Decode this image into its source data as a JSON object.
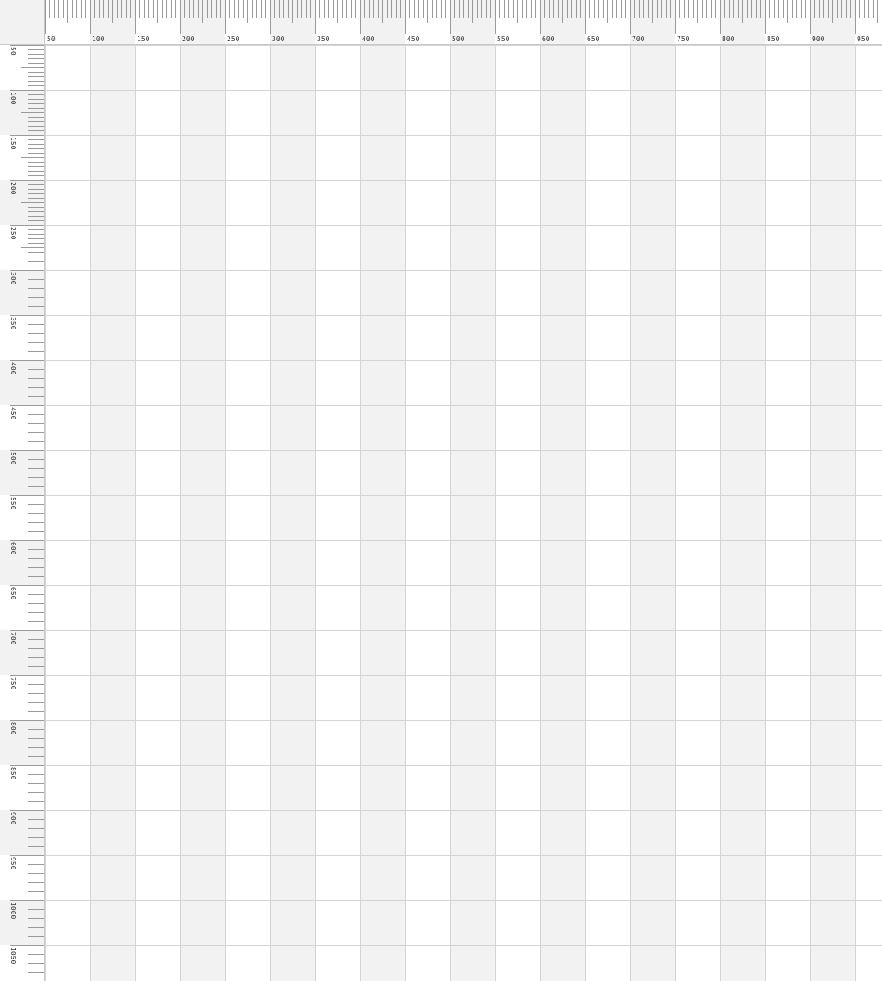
{
  "ruler": {
    "unit": "px",
    "major_step": 50,
    "minor_step": 5,
    "x_labels": [
      "50",
      "100",
      "150",
      "200",
      "250",
      "300",
      "350",
      "400",
      "450",
      "500",
      "550",
      "600",
      "650",
      "700",
      "750",
      "800",
      "850",
      "900",
      "950"
    ],
    "y_labels": [
      "50",
      "100",
      "150",
      "200",
      "250",
      "300",
      "350",
      "400",
      "450",
      "500",
      "550",
      "600",
      "650",
      "700",
      "750",
      "800",
      "850",
      "900",
      "950",
      "1000",
      "1050"
    ]
  },
  "colors": {
    "band_shade": "#f2f2f2",
    "grid_line": "#d4d4d4",
    "tick": "#9a9a9a",
    "label": "#333333",
    "canvas": "#ffffff"
  }
}
